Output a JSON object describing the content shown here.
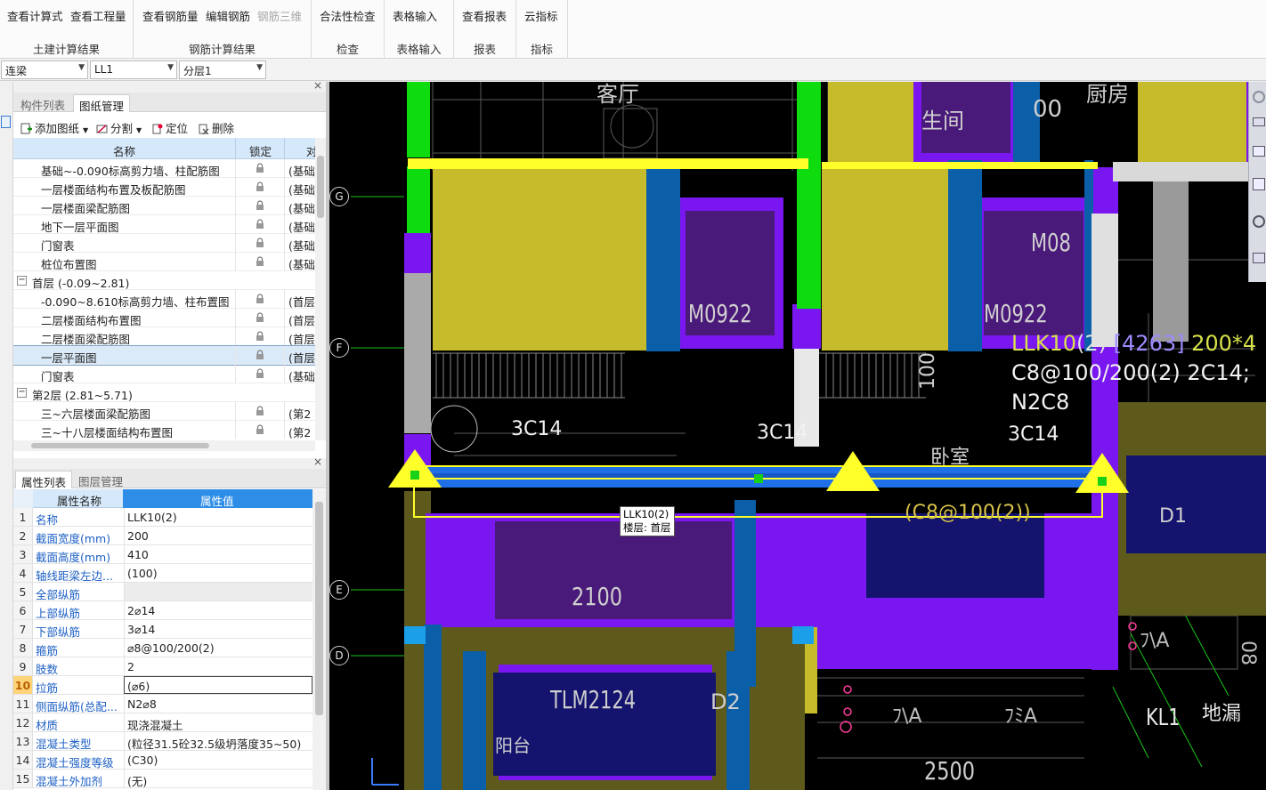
{
  "ribbon": {
    "groups": [
      {
        "label": "土建计算结果",
        "buttons": [
          "查看计算式",
          "查看工程量"
        ]
      },
      {
        "label": "钢筋计算结果",
        "buttons": [
          "查看钢筋量",
          "编辑钢筋",
          "钢筋三维"
        ]
      },
      {
        "label": "检查",
        "buttons": [
          "合法性检查"
        ]
      },
      {
        "label": "表格输入",
        "buttons": [
          "表格输入"
        ]
      },
      {
        "label": "报表",
        "buttons": [
          "查看报表"
        ]
      },
      {
        "label": "指标",
        "buttons": [
          "云指标"
        ]
      }
    ]
  },
  "selectors": {
    "category": "连梁",
    "element": "LL1",
    "floor": "分层1"
  },
  "top_panel": {
    "tabs": [
      "构件列表",
      "图纸管理"
    ],
    "active_tab": "图纸管理",
    "toolbar": {
      "add": "添加图纸",
      "split": "分割",
      "locate": "定位",
      "delete": "删除"
    },
    "columns": {
      "name": "名称",
      "lock": "锁定",
      "layer": "对"
    },
    "rows": [
      {
        "type": "item",
        "name": "基础~-0.090标高剪力墙、柱配筋图",
        "layer": "(基础",
        "lock": true
      },
      {
        "type": "item",
        "name": "一层楼面结构布置及板配筋图",
        "layer": "(基础",
        "lock": true
      },
      {
        "type": "item",
        "name": "一层楼面梁配筋图",
        "layer": "(基础",
        "lock": true
      },
      {
        "type": "item",
        "name": "地下一层平面图",
        "layer": "(基础",
        "lock": true
      },
      {
        "type": "item",
        "name": "门窗表",
        "layer": "(基础",
        "lock": true
      },
      {
        "type": "item",
        "name": "桩位布置图",
        "layer": "(基础",
        "lock": true
      },
      {
        "type": "group",
        "name": "首层 (-0.09~2.81)"
      },
      {
        "type": "item",
        "name": "-0.090~8.610标高剪力墙、柱布置图",
        "layer": "(首层",
        "lock": true
      },
      {
        "type": "item",
        "name": "二层楼面结构布置图",
        "layer": "(首层",
        "lock": true
      },
      {
        "type": "item",
        "name": "二层楼面梁配筋图",
        "layer": "(首层",
        "lock": true
      },
      {
        "type": "item",
        "name": "一层平面图",
        "layer": "(首层",
        "lock": true,
        "selected": true
      },
      {
        "type": "item",
        "name": "门窗表",
        "layer": "(基础",
        "lock": true
      },
      {
        "type": "group",
        "name": "第2层 (2.81~5.71)"
      },
      {
        "type": "item",
        "name": "三~六层楼面梁配筋图",
        "layer": "(第2",
        "lock": true
      },
      {
        "type": "item",
        "name": "三~十八层楼面结构布置图",
        "layer": "(第2",
        "lock": true
      }
    ]
  },
  "bottom_panel": {
    "tabs": [
      "属性列表",
      "图层管理"
    ],
    "active_tab": "属性列表",
    "columns": {
      "name": "属性名称",
      "value": "属性值"
    },
    "rows": [
      {
        "no": "1",
        "name": "名称",
        "value": "LLK10(2)"
      },
      {
        "no": "2",
        "name": "截面宽度(mm)",
        "value": "200"
      },
      {
        "no": "3",
        "name": "截面高度(mm)",
        "value": "410"
      },
      {
        "no": "4",
        "name": "轴线距梁左边...",
        "value": "(100)"
      },
      {
        "no": "5",
        "name": "全部纵筋",
        "value": "",
        "grey": true
      },
      {
        "no": "6",
        "name": "上部纵筋",
        "value": "2⌀14"
      },
      {
        "no": "7",
        "name": "下部纵筋",
        "value": "3⌀14"
      },
      {
        "no": "8",
        "name": "箍筋",
        "value": "⌀8@100/200(2)"
      },
      {
        "no": "9",
        "name": "肢数",
        "value": "2"
      },
      {
        "no": "10",
        "name": "拉筋",
        "value": "(⌀6)",
        "active": true
      },
      {
        "no": "11",
        "name": "侧面纵筋(总配...",
        "value": "N2⌀8"
      },
      {
        "no": "12",
        "name": "材质",
        "value": "现浇混凝土"
      },
      {
        "no": "13",
        "name": "混凝土类型",
        "value": "(粒径31.5砼32.5级坍落度35~50)"
      },
      {
        "no": "14",
        "name": "混凝土强度等级",
        "value": "(C30)"
      },
      {
        "no": "15",
        "name": "混凝土外加剂",
        "value": "(无)"
      }
    ]
  },
  "cad": {
    "axis_labels": [
      "G",
      "F",
      "E",
      "D"
    ],
    "room_labels": {
      "living": "客厅",
      "bath": "生间",
      "kitchen": "厨房",
      "bedroom": "卧室",
      "balcony": "阳台"
    },
    "door_labels": {
      "m1": "M0922",
      "m2": "M0922",
      "m3": "M08",
      "tlm": "TLM2124",
      "d1": "D1",
      "d2": "D2",
      "num1": "00",
      "num2": "100"
    },
    "dims": {
      "d2100": "2100",
      "d2500": "2500",
      "d08": "08"
    },
    "beam_annotations": {
      "rebar_left": "3C14",
      "rebar_mid": "3C14",
      "rebar_right": "3C14",
      "callout_line1_a": "LLK10",
      "callout_line1_b": "(2)",
      "callout_line1_c": "[4263]",
      "callout_line1_d": "200*4",
      "callout_line2": "C8@100/200(2) 2C14;",
      "callout_line3": "N2C8",
      "stirrup": "(C8@100(2))"
    },
    "kl_label": "KL1",
    "misc_text": {
      "t1": "地漏",
      "t2": "ﾌ\\A",
      "t3": "ﾌﾐA",
      "t4": "ﾌ\\A"
    },
    "tooltip": {
      "line1": "LLK10(2)",
      "line2": "楼层: 首层"
    }
  },
  "colors": {
    "beam_blue": "#1e6fe8",
    "wall_purple": "#7a16f0",
    "yellow": "#c6bb2b",
    "highlight": "#ffff2a"
  }
}
